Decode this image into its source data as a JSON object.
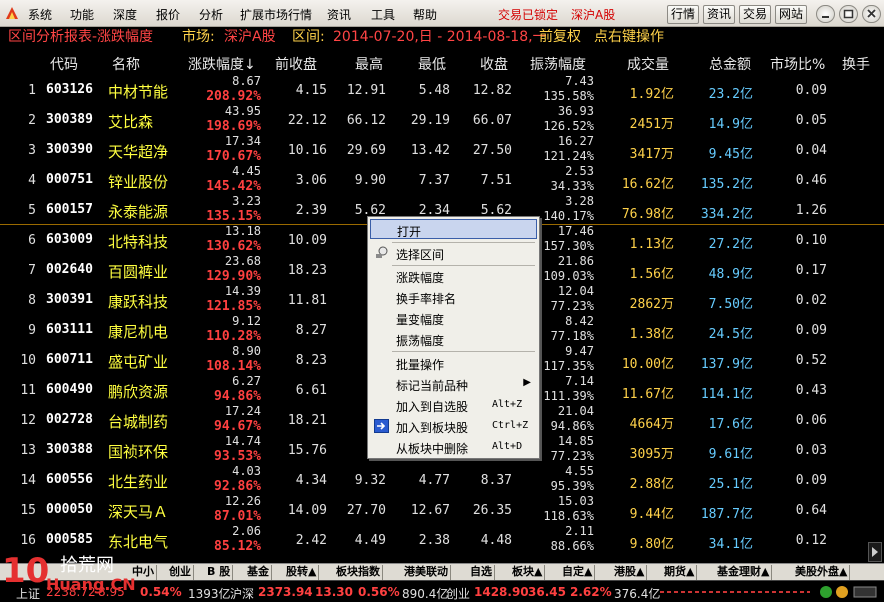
{
  "menu": {
    "items": [
      "系统",
      "功能",
      "深度",
      "报价",
      "分析",
      "扩展市场行情",
      "资讯",
      "工具",
      "帮助"
    ],
    "status_left": "交易已锁定",
    "status_right": "深沪A股",
    "buttons": [
      "行情",
      "资讯",
      "交易",
      "网站"
    ]
  },
  "title": {
    "report": "区间分析报表-涨跌幅度",
    "market_label": "市场:",
    "market": "深沪A股",
    "range_label": "区间:",
    "range": "2014-07-20,日 - 2014-08-18,一",
    "adjust": "前复权",
    "hint": "点右键操作"
  },
  "table": {
    "headers": [
      "代码",
      "名称",
      "涨跌幅度↓",
      "前收盘",
      "最高",
      "最低",
      "收盘",
      "振荡幅度",
      "成交量",
      "总金额",
      "市场比%",
      "换手"
    ],
    "rows": [
      {
        "idx": "1",
        "code": "603126",
        "name": "中材节能",
        "pend": "8.67",
        "chg": "208.92%",
        "prev": "4.15",
        "high": "12.91",
        "low": "5.48",
        "close": "12.82",
        "amp1": "7.43",
        "amp2": "135.58%",
        "vol": "1.92",
        "vol_unit": "亿",
        "amt": "23.2",
        "amt_unit": "亿",
        "mkt": "0.09"
      },
      {
        "idx": "2",
        "code": "300389",
        "name": "艾比森",
        "pend": "43.95",
        "chg": "198.69%",
        "prev": "22.12",
        "high": "66.12",
        "low": "29.19",
        "close": "66.07",
        "amp1": "36.93",
        "amp2": "126.52%",
        "vol": "2451",
        "vol_unit": "万",
        "amt": "14.9",
        "amt_unit": "亿",
        "mkt": "0.05"
      },
      {
        "idx": "3",
        "code": "300390",
        "name": "天华超净",
        "pend": "17.34",
        "chg": "170.67%",
        "prev": "10.16",
        "high": "29.69",
        "low": "13.42",
        "close": "27.50",
        "amp1": "16.27",
        "amp2": "121.24%",
        "vol": "3417",
        "vol_unit": "万",
        "amt": "9.45",
        "amt_unit": "亿",
        "mkt": "0.04"
      },
      {
        "idx": "4",
        "code": "000751",
        "name": "锌业股份",
        "pend": "4.45",
        "chg": "145.42%",
        "prev": "3.06",
        "high": "9.90",
        "low": "7.37",
        "close": "7.51",
        "amp1": "2.53",
        "amp2": "34.33%",
        "vol": "16.62",
        "vol_unit": "亿",
        "amt": "135.2",
        "amt_unit": "亿",
        "mkt": "0.46"
      },
      {
        "idx": "5",
        "code": "600157",
        "name": "永泰能源",
        "pend": "3.23",
        "chg": "135.15%",
        "prev": "2.39",
        "high": "5.62",
        "low": "2.34",
        "close": "5.62",
        "amp1": "3.28",
        "amp2": "140.17%",
        "vol": "76.98",
        "vol_unit": "亿",
        "amt": "334.2",
        "amt_unit": "亿",
        "mkt": "1.26"
      },
      {
        "idx": "6",
        "code": "603009",
        "name": "北特科技",
        "pend": "13.18",
        "chg": "130.62%",
        "prev": "10.09",
        "high": "28",
        "low": "",
        "close": "",
        "amp1": "17.46",
        "amp2": "157.30%",
        "vol": "1.13",
        "vol_unit": "亿",
        "amt": "27.2",
        "amt_unit": "亿",
        "mkt": "0.10"
      },
      {
        "idx": "7",
        "code": "002640",
        "name": "百圆裤业",
        "pend": "23.68",
        "chg": "129.90%",
        "prev": "18.23",
        "high": "41",
        "low": "",
        "close": "",
        "amp1": "21.86",
        "amp2": "109.03%",
        "vol": "1.56",
        "vol_unit": "亿",
        "amt": "48.9",
        "amt_unit": "亿",
        "mkt": "0.17"
      },
      {
        "idx": "8",
        "code": "300391",
        "name": "康跃科技",
        "pend": "14.39",
        "chg": "121.85%",
        "prev": "11.81",
        "high": "27",
        "low": "",
        "close": "",
        "amp1": "12.04",
        "amp2": "77.23%",
        "vol": "2862",
        "vol_unit": "万",
        "amt": "7.50",
        "amt_unit": "亿",
        "mkt": "0.02"
      },
      {
        "idx": "9",
        "code": "603111",
        "name": "康尼机电",
        "pend": "9.12",
        "chg": "110.28%",
        "prev": "8.27",
        "high": "19",
        "low": "",
        "close": "",
        "amp1": "8.42",
        "amp2": "77.18%",
        "vol": "1.38",
        "vol_unit": "亿",
        "amt": "24.5",
        "amt_unit": "亿",
        "mkt": "0.09"
      },
      {
        "idx": "10",
        "code": "600711",
        "name": "盛屯矿业",
        "pend": "8.90",
        "chg": "108.14%",
        "prev": "8.23",
        "high": "17",
        "low": "",
        "close": "",
        "amp1": "9.47",
        "amp2": "117.35%",
        "vol": "10.00",
        "vol_unit": "亿",
        "amt": "137.9",
        "amt_unit": "亿",
        "mkt": "0.52"
      },
      {
        "idx": "11",
        "code": "600490",
        "name": "鹏欣资源",
        "pend": "6.27",
        "chg": "94.86%",
        "prev": "6.61",
        "high": "13",
        "low": "",
        "close": "",
        "amp1": "7.14",
        "amp2": "111.39%",
        "vol": "11.67",
        "vol_unit": "亿",
        "amt": "114.1",
        "amt_unit": "亿",
        "mkt": "0.43"
      },
      {
        "idx": "12",
        "code": "002728",
        "name": "台城制药",
        "pend": "17.24",
        "chg": "94.67%",
        "prev": "18.21",
        "high": "43",
        "low": "",
        "close": "",
        "amp1": "21.04",
        "amp2": "94.86%",
        "vol": "4664",
        "vol_unit": "万",
        "amt": "17.6",
        "amt_unit": "亿",
        "mkt": "0.06"
      },
      {
        "idx": "13",
        "code": "300388",
        "name": "国祯环保",
        "pend": "14.74",
        "chg": "93.53%",
        "prev": "15.76",
        "high": "34",
        "low": "",
        "close": "",
        "amp1": "14.85",
        "amp2": "77.23%",
        "vol": "3095",
        "vol_unit": "万",
        "amt": "9.61",
        "amt_unit": "亿",
        "mkt": "0.03"
      },
      {
        "idx": "14",
        "code": "600556",
        "name": "北生药业",
        "pend": "4.03",
        "chg": "92.86%",
        "prev": "4.34",
        "high": "9.32",
        "low": "4.77",
        "close": "8.37",
        "amp1": "4.55",
        "amp2": "95.39%",
        "vol": "2.88",
        "vol_unit": "亿",
        "amt": "25.1",
        "amt_unit": "亿",
        "mkt": "0.09"
      },
      {
        "idx": "15",
        "code": "000050",
        "name": "深天马Ａ",
        "pend": "12.26",
        "chg": "87.01%",
        "prev": "14.09",
        "high": "27.70",
        "low": "12.67",
        "close": "26.35",
        "amp1": "15.03",
        "amp2": "118.63%",
        "vol": "9.44",
        "vol_unit": "亿",
        "amt": "187.7",
        "amt_unit": "亿",
        "mkt": "0.64"
      },
      {
        "idx": "16",
        "code": "000585",
        "name": "东北电气",
        "pend": "2.06",
        "chg": "85.12%",
        "prev": "2.42",
        "high": "4.49",
        "low": "2.38",
        "close": "4.48",
        "amp1": "2.11",
        "amp2": "88.66%",
        "vol": "9.80",
        "vol_unit": "亿",
        "amt": "34.1",
        "amt_unit": "亿",
        "mkt": "0.12"
      }
    ]
  },
  "context_menu": {
    "items": [
      {
        "label": "打开",
        "shortcut": "",
        "icon": ""
      },
      {
        "label": "选择区间",
        "shortcut": "",
        "icon": "select-range-icon"
      },
      {
        "label": "涨跌幅度",
        "shortcut": "",
        "icon": ""
      },
      {
        "label": "换手率排名",
        "shortcut": "",
        "icon": ""
      },
      {
        "label": "量变幅度",
        "shortcut": "",
        "icon": ""
      },
      {
        "label": "振荡幅度",
        "shortcut": "",
        "icon": ""
      },
      {
        "label": "批量操作",
        "shortcut": "",
        "icon": ""
      },
      {
        "label": "标记当前品种",
        "shortcut": "",
        "icon": "submenu-arrow-icon"
      },
      {
        "label": "加入到自选股",
        "shortcut": "Alt+Z",
        "icon": ""
      },
      {
        "label": "加入到板块股",
        "shortcut": "Ctrl+Z",
        "icon": "add-to-block-icon"
      },
      {
        "label": "从板块中删除",
        "shortcut": "Alt+D",
        "icon": ""
      }
    ]
  },
  "tabs": [
    "中小",
    "创业",
    "B 股",
    "基金",
    "股转▲",
    "板块指数",
    "港美联动",
    "自选",
    "板块▲",
    "自定▲",
    "港股▲",
    "期货▲",
    "基金理财▲",
    "美股外盘▲"
  ],
  "status": {
    "sh_label": "上证",
    "sh_value": "2238.72",
    "sh_change": "8.95",
    "sh_pct": "0.54%",
    "sh_amount": "1393亿",
    "sz_label": "沪深",
    "sz_value": "2373.94",
    "sz_change": "13.30",
    "sz_pct": "0.56%",
    "sz_amount": "890.4亿",
    "cy_label": "创业",
    "cy_value": "1428.90",
    "cy_change": "36.45",
    "cy_pct": "2.62%",
    "cy_amount": "376.4亿"
  },
  "watermark": {
    "big": "10",
    "cn": "拾荒网",
    "site": "Huang.CN"
  },
  "colors": {
    "up": "#ff4040",
    "name": "#ffff40",
    "volume": "#ffd24a",
    "amount": "#66ccff",
    "title_red": "#ff4545",
    "title_yellow": "#ffd24a",
    "menu_status": "#d40000"
  }
}
